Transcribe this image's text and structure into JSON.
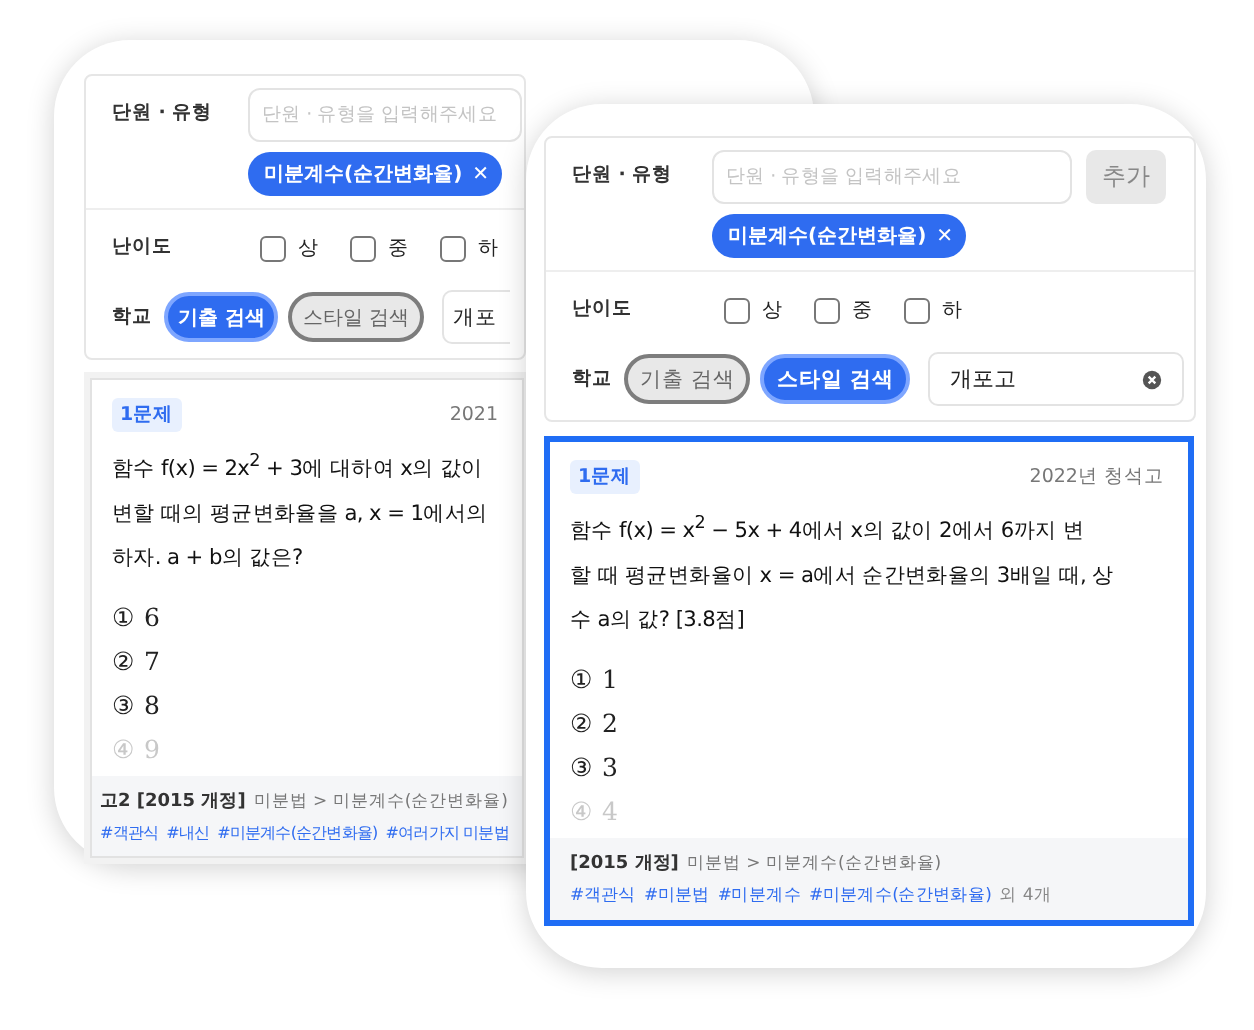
{
  "panels": [
    {
      "filters": {
        "unit_label": "단원 · 유형",
        "unit_placeholder": "단원 · 유형을 입력해주세요",
        "chips": [
          {
            "label": "미분계수(순간변화율)",
            "remove": "✕"
          }
        ],
        "difficulty_label": "난이도",
        "difficulty": [
          {
            "label": "상",
            "checked": false
          },
          {
            "label": "중",
            "checked": false
          },
          {
            "label": "하",
            "checked": false
          }
        ],
        "school_label": "학교",
        "search_modes": [
          {
            "label": "기출 검색",
            "selected": true
          },
          {
            "label": "스타일 검색",
            "selected": false
          }
        ],
        "school_field": {
          "value": "개포"
        }
      },
      "question": {
        "highlighted": false,
        "badge": "1문제",
        "source": "2021",
        "text": "함수 f(x) = 2x$^{2}$ + 3에 대하여 x의 값이\n변할 때의 평균변화율을 a, x = 1에서의\n하자. a + b의 값은?",
        "choices": [
          {
            "label": "① 6",
            "faded": false
          },
          {
            "label": "② 7",
            "faded": false
          },
          {
            "label": "③ 8",
            "faded": false
          },
          {
            "label": "④ 9",
            "faded": true
          }
        ],
        "curriculum": "고2 [2015 개정]",
        "path": "미분법 > 미분계수(순간변화율)",
        "tags": [
          "#객관식",
          "#내신",
          "#미분계수(순간변화율)",
          "#여러가지 미분법"
        ]
      }
    },
    {
      "filters": {
        "unit_label": "단원 · 유형",
        "unit_placeholder": "단원 · 유형을 입력해주세요",
        "add_button": "추가",
        "chips": [
          {
            "label": "미분계수(순간변화율)",
            "remove": "✕"
          }
        ],
        "difficulty_label": "난이도",
        "difficulty": [
          {
            "label": "상",
            "checked": false
          },
          {
            "label": "중",
            "checked": false
          },
          {
            "label": "하",
            "checked": false
          }
        ],
        "school_label": "학교",
        "search_modes": [
          {
            "label": "기출 검색",
            "selected": false
          },
          {
            "label": "스타일 검색",
            "selected": true
          }
        ],
        "school_field": {
          "value": "개포고",
          "clearable": true
        }
      },
      "question": {
        "highlighted": true,
        "badge": "1문제",
        "source": "2022년 청석고",
        "text": "함수 f(x) = x$^{2}$ − 5x + 4에서 x의 값이 2에서 6까지 변\n할 때 평균변화율이 x = a에서 순간변화율의 3배일 때, 상\n수 a의 값? [3.8점]",
        "choices": [
          {
            "label": "① 1",
            "faded": false
          },
          {
            "label": "② 2",
            "faded": false
          },
          {
            "label": "③ 3",
            "faded": false
          },
          {
            "label": "④ 4",
            "faded": true
          }
        ],
        "curriculum": "[2015 개정]",
        "path": "미분법 > 미분계수(순간변화율)",
        "tags": [
          "#객관식",
          "#미분법",
          "#미분계수",
          "#미분계수(순간변화율)"
        ],
        "more": "외 4개"
      }
    }
  ]
}
